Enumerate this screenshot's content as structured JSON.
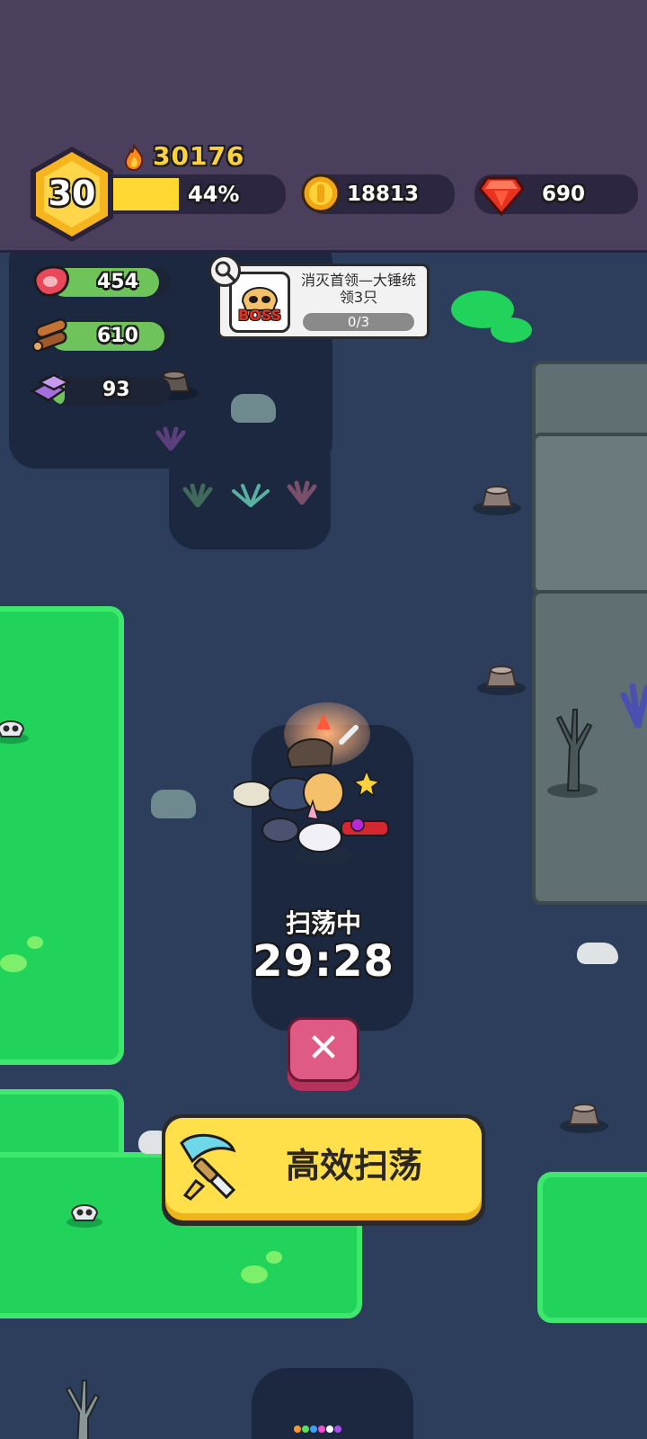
{
  "player": {
    "level": "30",
    "power": "30176",
    "xp_percent_label": "44%",
    "xp_percent": 44
  },
  "currencies": {
    "gold": "18813",
    "gems": "690"
  },
  "resources": {
    "meat": {
      "value": "454",
      "fill": 0.9
    },
    "wood": {
      "value": "610",
      "fill": 0.95
    },
    "ore": {
      "value": "93",
      "fill": 0.12
    }
  },
  "quest": {
    "badge": "BOSS",
    "title": "消灭首领—大锤统领3只",
    "progress": "0/3"
  },
  "sweep": {
    "status": "扫荡中",
    "timer": "29:28",
    "cancel_symbol": "✕",
    "efficient_label": "高效扫荡"
  },
  "colors": {
    "accent": "#ffd23a",
    "button": "#ffd93d",
    "cancel": "#e05a86",
    "grass": "#21d35a",
    "map": "#2d3d5c",
    "topbar": "#4a405e"
  },
  "icons": [
    "fire-icon",
    "gold-coin-icon",
    "gem-icon",
    "meat-icon",
    "wood-icon",
    "ore-icon",
    "magnifier-icon",
    "boss-skull-icon",
    "sword-icon",
    "close-icon"
  ]
}
